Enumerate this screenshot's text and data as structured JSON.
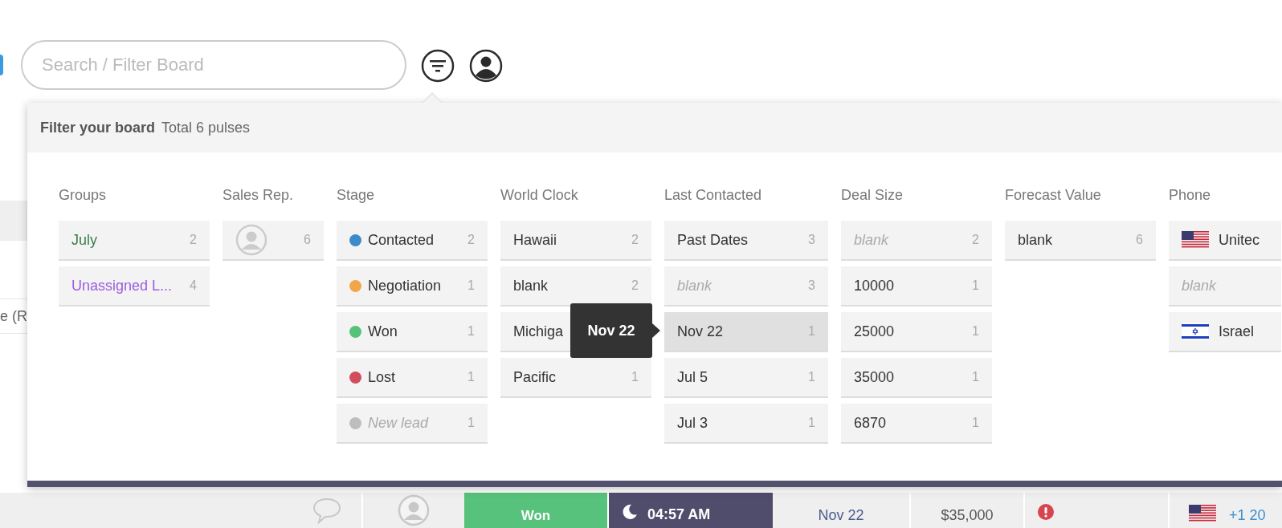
{
  "search": {
    "placeholder": "Search / Filter Board"
  },
  "filter_panel": {
    "title": "Filter your board",
    "subtitle": "Total 6 pulses",
    "columns": [
      {
        "heading": "Groups",
        "options": [
          {
            "kind": "group",
            "label": "July",
            "count": "2",
            "color": "#3b7d4e",
            "selected": false
          },
          {
            "kind": "group",
            "label": "Unassigned L...",
            "count": "4",
            "color": "#9d5de0",
            "selected": false
          }
        ]
      },
      {
        "heading": "Sales Rep.",
        "options": [
          {
            "kind": "avatar",
            "count": "6",
            "selected": false
          }
        ]
      },
      {
        "heading": "Stage",
        "options": [
          {
            "kind": "status",
            "label": "Contacted",
            "count": "2",
            "color": "#3d8ac7",
            "empty": false,
            "selected": false
          },
          {
            "kind": "status",
            "label": "Negotiation",
            "count": "1",
            "color": "#f2a64a",
            "empty": false,
            "selected": false
          },
          {
            "kind": "status",
            "label": "Won",
            "count": "1",
            "color": "#55c27a",
            "empty": false,
            "selected": false
          },
          {
            "kind": "status",
            "label": "Lost",
            "count": "1",
            "color": "#d14d5b",
            "empty": false,
            "selected": false
          },
          {
            "kind": "status",
            "label": "New lead",
            "count": "1",
            "color": "#bdbdbd",
            "empty": true,
            "selected": false
          }
        ]
      },
      {
        "heading": "World Clock",
        "options": [
          {
            "kind": "text",
            "label": "Hawaii",
            "count": "2",
            "empty": false,
            "selected": false
          },
          {
            "kind": "text",
            "label": "blank",
            "count": "2",
            "empty": false,
            "selected": false
          },
          {
            "kind": "text",
            "label": "Michiga",
            "empty": false,
            "selected": false
          },
          {
            "kind": "text",
            "label": "Pacific",
            "count": "1",
            "empty": false,
            "selected": false
          }
        ]
      },
      {
        "heading": "Last Contacted",
        "options": [
          {
            "kind": "text",
            "label": "Past Dates",
            "count": "3",
            "empty": false,
            "selected": false
          },
          {
            "kind": "text",
            "label": "blank",
            "count": "3",
            "empty": true,
            "selected": false
          },
          {
            "kind": "text",
            "label": "Nov 22",
            "count": "1",
            "empty": false,
            "selected": true
          },
          {
            "kind": "text",
            "label": "Jul 5",
            "count": "1",
            "empty": false,
            "selected": false
          },
          {
            "kind": "text",
            "label": "Jul 3",
            "count": "1",
            "empty": false,
            "selected": false
          }
        ]
      },
      {
        "heading": "Deal Size",
        "options": [
          {
            "kind": "text",
            "label": "blank",
            "count": "2",
            "empty": true,
            "selected": false
          },
          {
            "kind": "text",
            "label": "10000",
            "count": "1",
            "empty": false,
            "selected": false
          },
          {
            "kind": "text",
            "label": "25000",
            "count": "1",
            "empty": false,
            "selected": false
          },
          {
            "kind": "text",
            "label": "35000",
            "count": "1",
            "empty": false,
            "selected": false
          },
          {
            "kind": "text",
            "label": "6870",
            "count": "1",
            "empty": false,
            "selected": false
          }
        ]
      },
      {
        "heading": "Forecast Value",
        "options": [
          {
            "kind": "text",
            "label": "blank",
            "count": "6",
            "empty": false,
            "selected": false
          }
        ]
      },
      {
        "heading": "Phone",
        "options": [
          {
            "kind": "flag_us",
            "label": "Unitec",
            "empty": false,
            "selected": false
          },
          {
            "kind": "text",
            "label": "blank",
            "empty": true,
            "selected": false
          },
          {
            "kind": "flag_il",
            "label": "Israel",
            "empty": false,
            "selected": false
          }
        ]
      }
    ]
  },
  "tooltip": {
    "text": "Nov 22"
  },
  "board": {
    "partial_text": "e (R",
    "row": [
      {
        "kind": "comment"
      },
      {
        "kind": "person"
      },
      {
        "kind": "status",
        "label": "Won",
        "color": "#57c27b"
      },
      {
        "kind": "clock",
        "label": "04:57 AM"
      },
      {
        "kind": "date",
        "label": "Nov 22"
      },
      {
        "kind": "money",
        "label": "$35,000"
      },
      {
        "kind": "alert"
      },
      {
        "kind": "phone_us",
        "label": "+1 20"
      }
    ]
  }
}
